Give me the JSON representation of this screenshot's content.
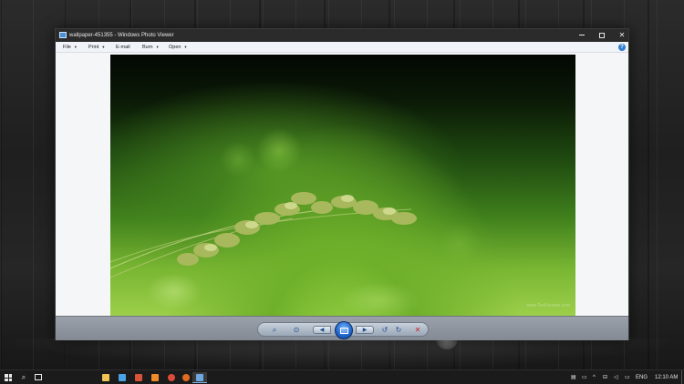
{
  "window": {
    "title": "wallpaper-451355 - Windows Photo Viewer",
    "controls": {
      "minimize": "minimize-icon",
      "maximize": "maximize-icon",
      "close": "close-icon"
    }
  },
  "menu": {
    "file": "File",
    "print": "Print",
    "email": "E-mail",
    "burn": "Burn",
    "open": "Open",
    "help_icon": "help-icon"
  },
  "photo": {
    "watermark": "www.TenForums.com"
  },
  "viewer_controls": {
    "zoom_icon": "zoom-icon",
    "fit_icon": "actual-size-icon",
    "prev_icon": "previous-icon",
    "slideshow_icon": "slideshow-icon",
    "next_icon": "next-icon",
    "rotate_left_icon": "rotate-counterclockwise-icon",
    "rotate_right_icon": "rotate-clockwise-icon",
    "delete_icon": "delete-icon"
  },
  "taskbar": {
    "start_icon": "windows-logo-icon",
    "search_icon": "search-icon",
    "task_view_icon": "task-view-icon",
    "pinned_apps": [
      "file-explorer-icon",
      "mail-icon",
      "office-icon",
      "app-icon",
      "chrome-icon",
      "firefox-icon",
      "photo-viewer-icon"
    ],
    "language": "ENG",
    "clock": "12:10 AM"
  },
  "colors": {
    "titlebar": "#2b2b2b",
    "taskbar": "#1b1b1b",
    "accent": "#1f64c8",
    "delete": "#c8262a"
  }
}
